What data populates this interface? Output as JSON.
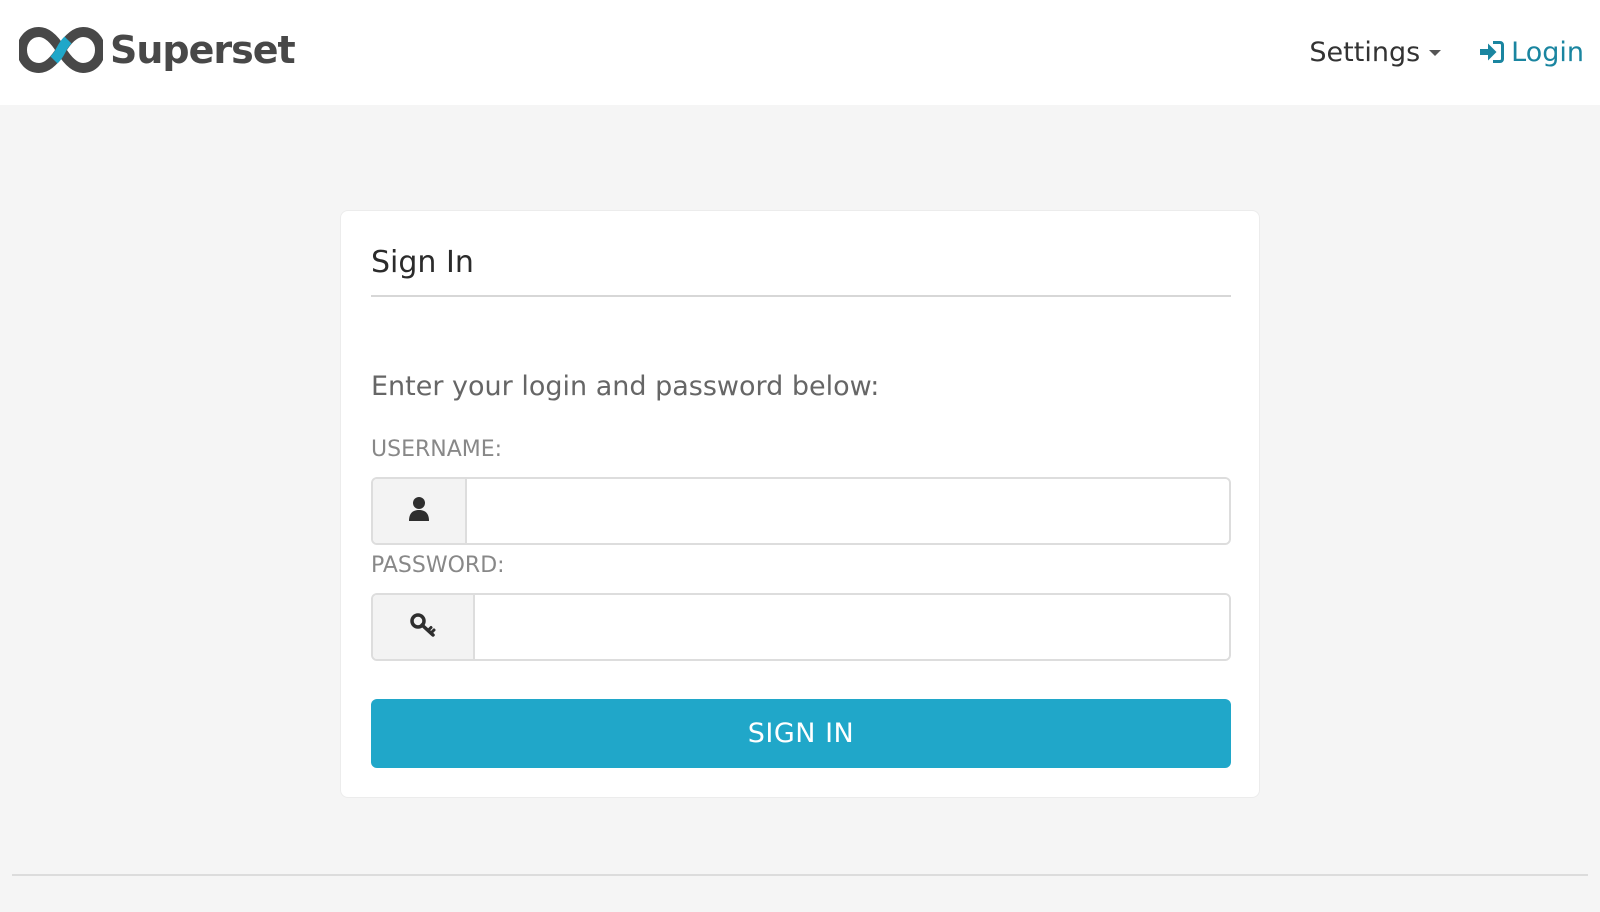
{
  "navbar": {
    "brand_name": "Superset",
    "logo_icon": "superset-infinity-logo",
    "settings_label": "Settings",
    "login_label": "Login",
    "login_icon": "sign-in-icon",
    "accent_color": "#1a85a0"
  },
  "login_form": {
    "title": "Sign In",
    "instructions": "Enter your login and password below:",
    "username": {
      "label": "USERNAME:",
      "value": "",
      "icon": "user-icon"
    },
    "password": {
      "label": "PASSWORD:",
      "value": "",
      "icon": "key-icon"
    },
    "submit_label": "SIGN IN",
    "button_color": "#20a7c9"
  }
}
